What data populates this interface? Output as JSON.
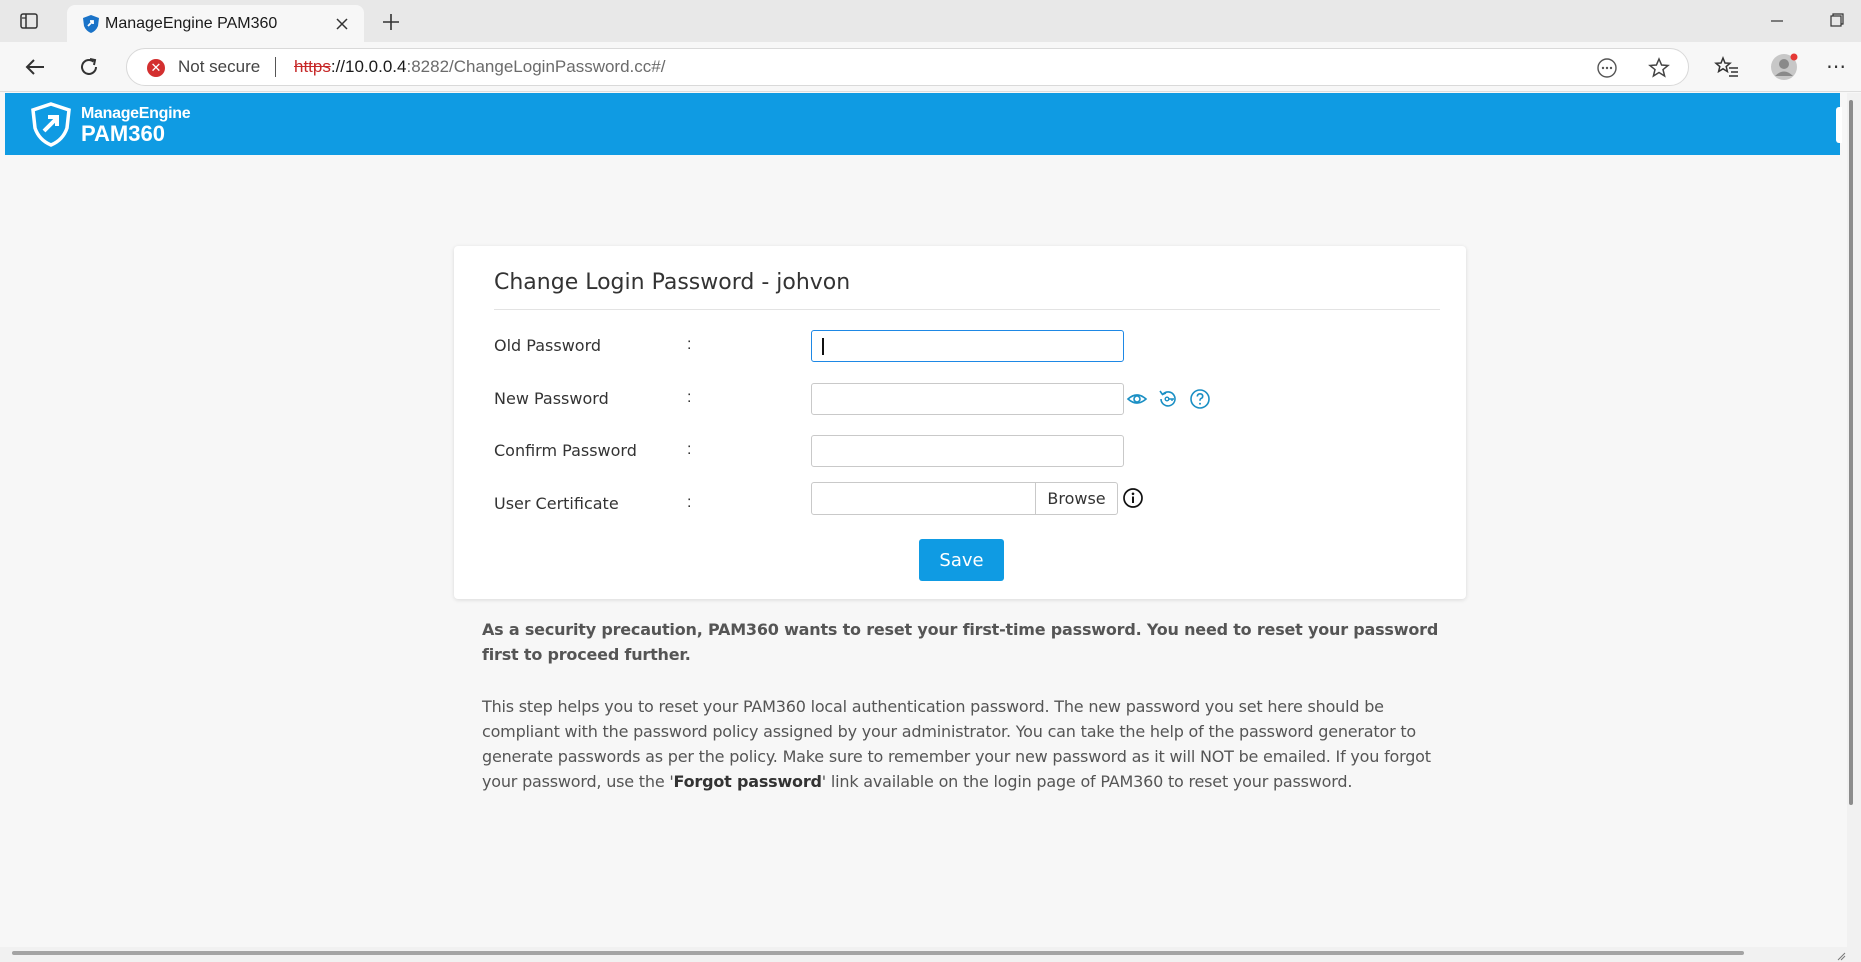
{
  "browser": {
    "tab_title": "ManageEngine PAM360",
    "not_secure": "Not secure",
    "url_scheme": "https",
    "url_host": "://10.0.0.4",
    "url_rest": ":8282/ChangeLoginPassword.cc#/"
  },
  "header": {
    "brand": "ManageEngine",
    "product": "PAM360"
  },
  "form": {
    "title": "Change Login Password  - johvon",
    "colon": ":",
    "old_password_label": "Old Password",
    "new_password_label": "New Password",
    "confirm_password_label": "Confirm Password",
    "user_certificate_label": "User Certificate",
    "browse_label": "Browse",
    "save_label": "Save"
  },
  "notes": {
    "precaution": "As a security precaution, PAM360 wants to reset your first-time password. You need to reset your password first to proceed further.",
    "help_part1": "This step helps you to reset your PAM360 local authentication password. The new password you set here should be compliant with the password policy assigned by your administrator. You can take the help of the password generator to generate passwords as per the policy. Make sure to remember your new password as it will NOT be emailed. If you forgot your password, use the '",
    "help_link": "Forgot password",
    "help_part2": "' link available on the login page of PAM360 to reset your password."
  },
  "colors": {
    "header_blue": "#0f9be3",
    "icon_teal": "#1a8fc4",
    "warning_red": "#d32f2f"
  }
}
